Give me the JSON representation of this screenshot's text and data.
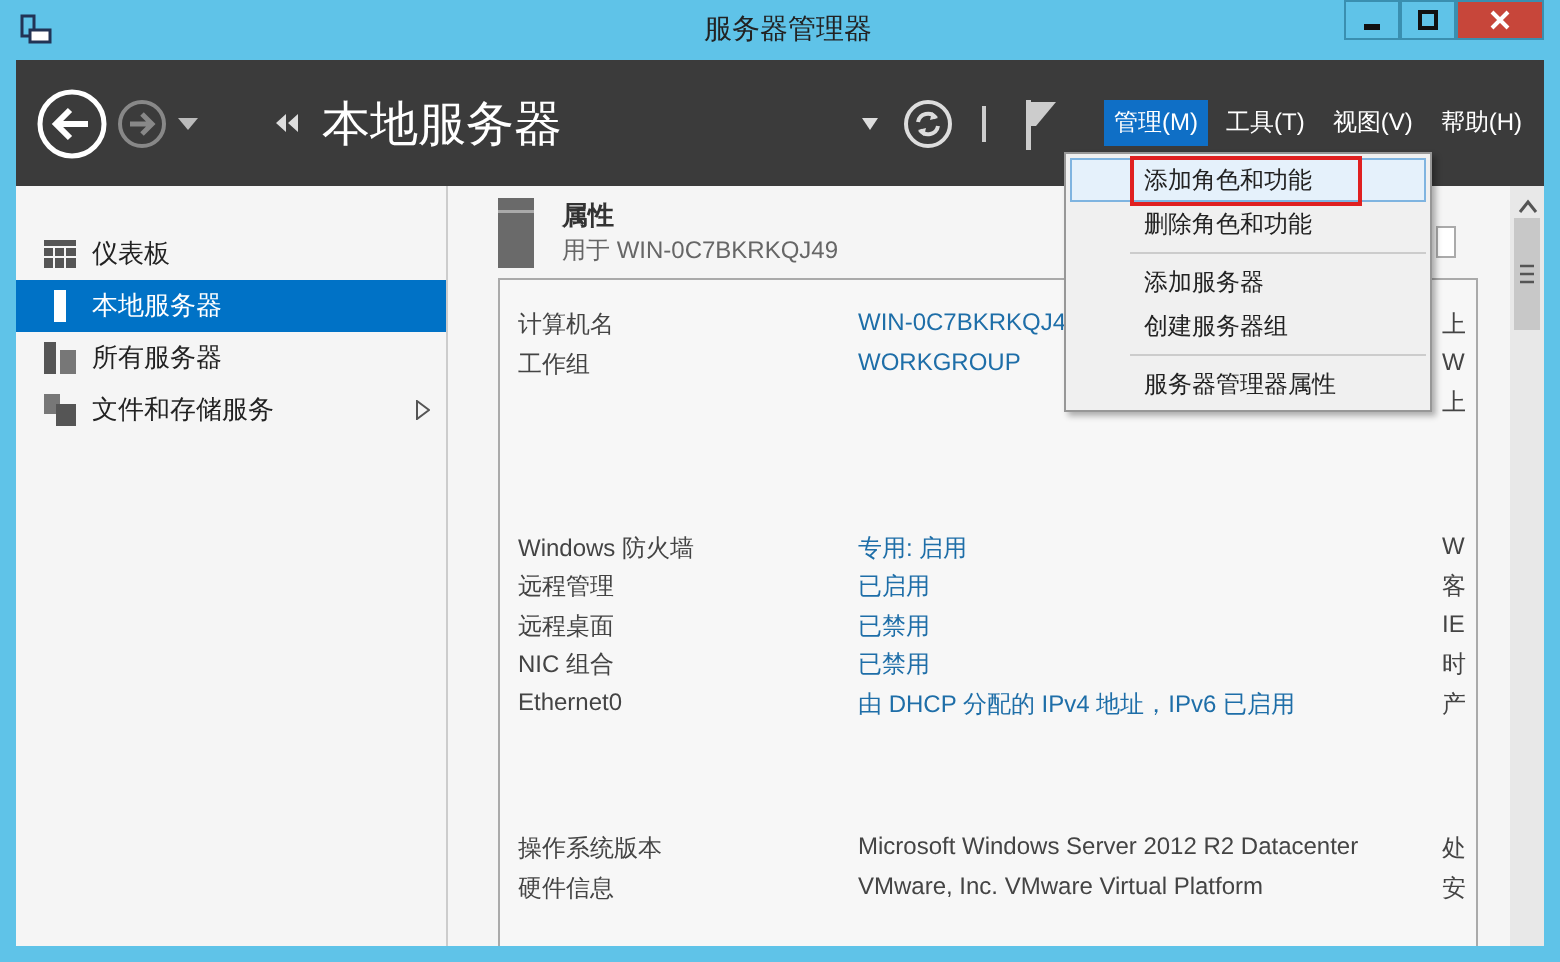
{
  "window": {
    "title": "服务器管理器"
  },
  "header": {
    "title": "本地服务器",
    "menus": [
      {
        "label": "管理(M)",
        "selected": true
      },
      {
        "label": "工具(T)",
        "selected": false
      },
      {
        "label": "视图(V)",
        "selected": false
      },
      {
        "label": "帮助(H)",
        "selected": false
      }
    ]
  },
  "sidebar": {
    "items": [
      {
        "label": "仪表板",
        "kind": "dashboard",
        "selected": false,
        "expandable": false
      },
      {
        "label": "本地服务器",
        "kind": "local",
        "selected": true,
        "expandable": false
      },
      {
        "label": "所有服务器",
        "kind": "all",
        "selected": false,
        "expandable": false
      },
      {
        "label": "文件和存储服务",
        "kind": "files",
        "selected": false,
        "expandable": true
      }
    ]
  },
  "properties": {
    "title": "属性",
    "subtitle": "用于 WIN-0C7BKRKQJ49",
    "groups": [
      {
        "rows": [
          {
            "label": "计算机名",
            "value": "WIN-0C7BKRKQJ4",
            "plain": false
          },
          {
            "label": "工作组",
            "value": "WORKGROUP",
            "plain": false
          }
        ],
        "column_3": [
          "上",
          "W",
          "上"
        ]
      },
      {
        "rows": [
          {
            "label": "Windows 防火墙",
            "value": "专用: 启用",
            "plain": false
          },
          {
            "label": "远程管理",
            "value": "已启用",
            "plain": false
          },
          {
            "label": "远程桌面",
            "value": "已禁用",
            "plain": false
          },
          {
            "label": "NIC 组合",
            "value": "已禁用",
            "plain": false
          },
          {
            "label": "Ethernet0",
            "value": "由 DHCP 分配的 IPv4 地址，IPv6 已启用",
            "plain": false
          }
        ],
        "column_3": [
          "W",
          "客",
          "IE",
          "时",
          "产"
        ]
      },
      {
        "rows": [
          {
            "label": "操作系统版本",
            "value": "Microsoft Windows Server 2012 R2 Datacenter",
            "plain": true
          },
          {
            "label": "硬件信息",
            "value": "VMware, Inc. VMware Virtual Platform",
            "plain": true
          }
        ],
        "column_3": [
          "处",
          "安"
        ]
      }
    ]
  },
  "menu": {
    "groups": [
      [
        {
          "label": "添加角色和功能",
          "selected": true,
          "annotated": true
        },
        {
          "label": "删除角色和功能",
          "selected": false,
          "annotated": false
        }
      ],
      [
        {
          "label": "添加服务器",
          "selected": false,
          "annotated": false
        },
        {
          "label": "创建服务器组",
          "selected": false,
          "annotated": false
        }
      ],
      [
        {
          "label": "服务器管理器属性",
          "selected": false,
          "annotated": false
        }
      ]
    ]
  }
}
